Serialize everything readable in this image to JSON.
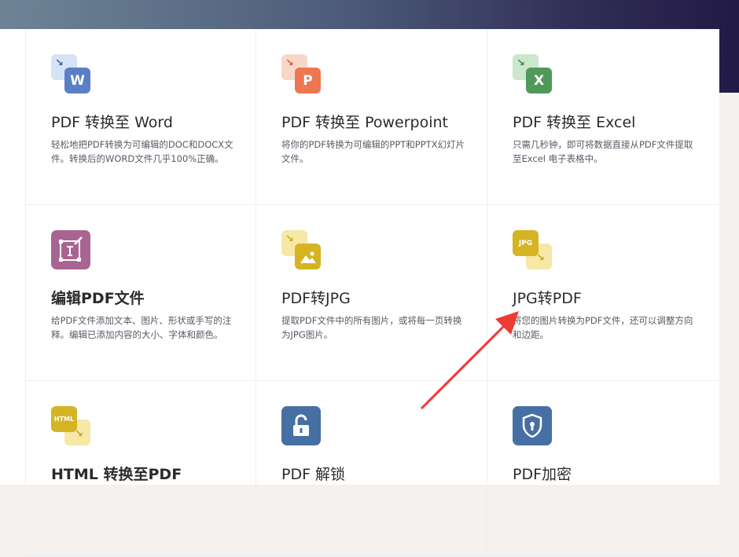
{
  "tools": [
    {
      "title": "PDF 转换至 Word",
      "desc": "轻松地把PDF转换为可编辑的DOC和DOCX文件。转换后的WORD文件几乎100%正确。",
      "icon_letter": "W",
      "colors": {
        "back": "#d6e2f5",
        "front": "#5b7fc7",
        "arrow": "#3a5fae"
      }
    },
    {
      "title": "PDF 转换至 Powerpoint",
      "desc": "将你的PDF转换为可编辑的PPT和PPTX幻灯片文件。",
      "icon_letter": "P",
      "colors": {
        "back": "#f8d7cb",
        "front": "#ee7651",
        "arrow": "#d9573a"
      }
    },
    {
      "title": "PDF 转换至 Excel",
      "desc": "只需几秒钟，即可将数据直接从PDF文件提取至Excel 电子表格中。",
      "icon_letter": "X",
      "colors": {
        "back": "#cbe7cd",
        "front": "#4f9a59",
        "arrow": "#3c8745"
      }
    },
    {
      "title": "编辑PDF文件",
      "desc": "给PDF文件添加文本、图片、形状或手写的注释。编辑已添加内容的大小、字体和颜色。",
      "colors": {
        "front": "#a86592"
      }
    },
    {
      "title": "PDF转JPG",
      "desc": "提取PDF文件中的所有图片，或将每一页转换为JPG图片。",
      "colors": {
        "back": "#f6e8a6",
        "front": "#d4b423",
        "arrow": "#c9a61a"
      }
    },
    {
      "title": "JPG转PDF",
      "desc": "将您的图片转换为PDF文件，还可以调整方向和边距。",
      "icon_label": "JPG",
      "colors": {
        "back": "#d4b423",
        "front": "#f6e8a6",
        "arrow": "#c9a61a"
      }
    },
    {
      "title": "HTML 转换至PDF",
      "icon_label": "HTML",
      "colors": {
        "back": "#d4b423",
        "front": "#f6e8a6",
        "arrow": "#c9a61a"
      }
    },
    {
      "title": "PDF 解锁",
      "colors": {
        "front": "#4670a3"
      }
    },
    {
      "title": "PDF加密",
      "colors": {
        "front": "#4670a3"
      }
    }
  ]
}
